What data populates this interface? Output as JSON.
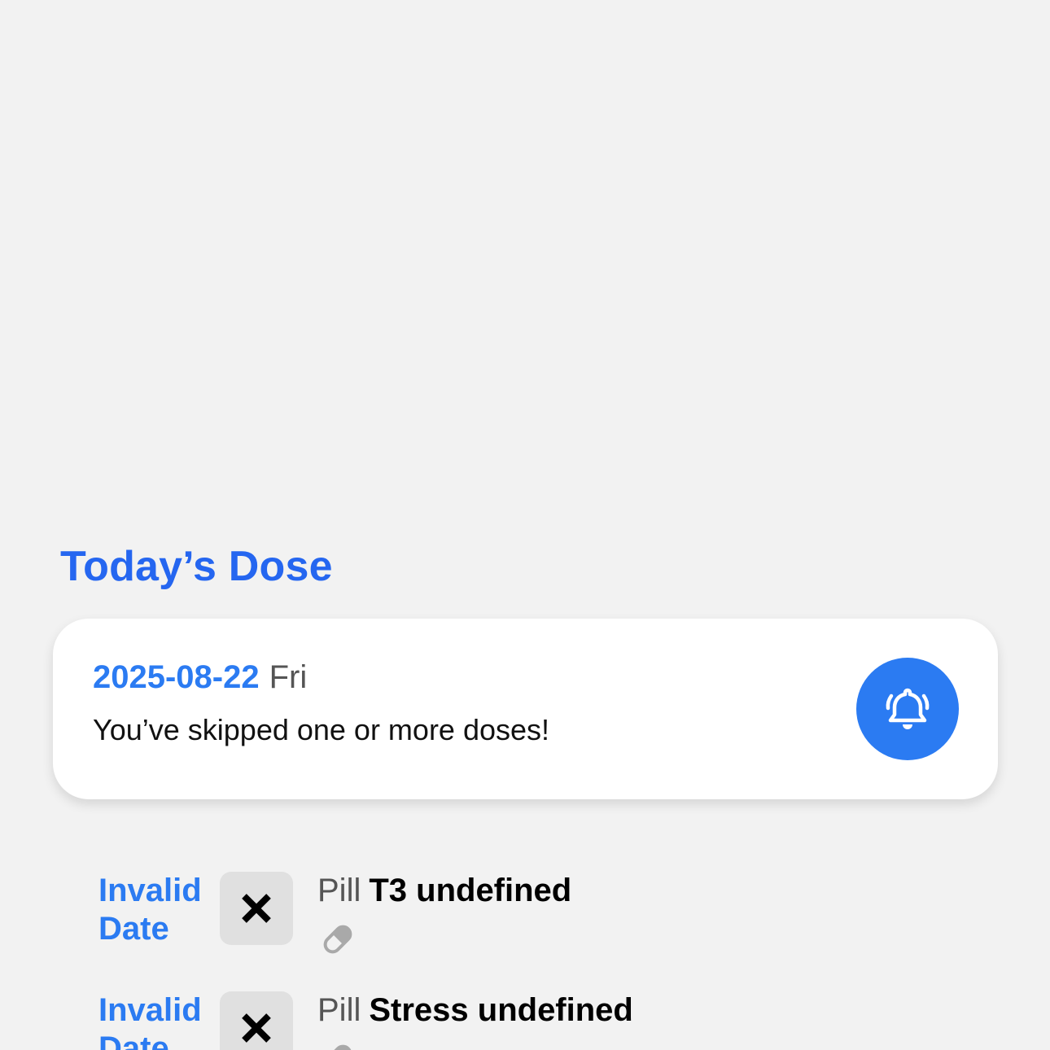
{
  "section": {
    "title": "Today’s Dose"
  },
  "summary": {
    "date": "2025-08-22",
    "weekday": "Fri",
    "message": "You’ve skipped one or more doses!",
    "alarm_icon": "bell-ring-icon",
    "accent_color": "#2b7bf2"
  },
  "doses": [
    {
      "time_line1": "Invalid",
      "time_line2": "Date",
      "status_icon": "close-icon",
      "type": "Pill",
      "name": "T3 undefined",
      "item_icon": "pill-icon"
    },
    {
      "time_line1": "Invalid",
      "time_line2": "Date",
      "status_icon": "close-icon",
      "type": "Pill",
      "name": "Stress undefined",
      "item_icon": "pill-icon"
    }
  ]
}
